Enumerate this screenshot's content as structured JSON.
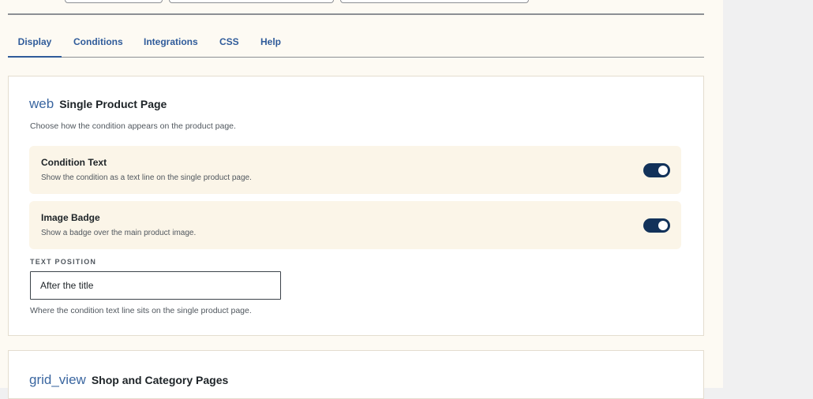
{
  "tabs": [
    {
      "label": "Display",
      "active": true
    },
    {
      "label": "Conditions",
      "active": false
    },
    {
      "label": "Integrations",
      "active": false
    },
    {
      "label": "CSS",
      "active": false
    },
    {
      "label": "Help",
      "active": false
    }
  ],
  "single_product": {
    "icon": "web",
    "title": "Single Product Page",
    "description": "Choose how the condition appears on the product page.",
    "settings": [
      {
        "label": "Condition Text",
        "help": "Show the condition as a text line on the single product page.",
        "enabled": true
      },
      {
        "label": "Image Badge",
        "help": "Show a badge over the main product image.",
        "enabled": true
      }
    ],
    "text_position": {
      "label": "TEXT POSITION",
      "value": "After the title",
      "help": "Where the condition text line sits on the single product page."
    }
  },
  "shop_category": {
    "icon": "grid_view",
    "title": "Shop and Category Pages"
  },
  "colors": {
    "accent": "#2f5b9a",
    "toggle_on": "#12325a",
    "panel_bg": "#fdfaf3",
    "row_bg": "#fbf5e8"
  }
}
